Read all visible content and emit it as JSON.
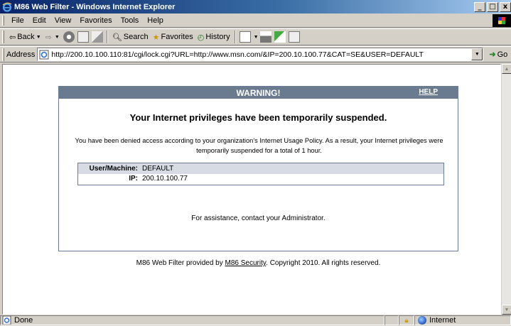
{
  "window": {
    "title": "M86 Web Filter - Windows Internet Explorer",
    "minimize": "_",
    "maximize": "□",
    "close": "x"
  },
  "menubar": {
    "items": [
      "File",
      "Edit",
      "View",
      "Favorites",
      "Tools",
      "Help"
    ]
  },
  "toolbar": {
    "back_label": "Back",
    "search_label": "Search",
    "favorites_label": "Favorites",
    "history_label": "History"
  },
  "addressbar": {
    "label": "Address",
    "url": "http://200.10.100.110:81/cgi/lock.cgi?URL=http://www.msn.com/&IP=200.10.100.77&CAT=SE&USER=DEFAULT",
    "go_label": "Go"
  },
  "page": {
    "header_title": "WARNING!",
    "help_link": "HELP",
    "headline": "Your Internet privileges have been temporarily suspended.",
    "body_text": "You have been denied access according to your organization's Internet Usage Policy. As a result, your Internet privileges were temporarily suspended for a total of 1 hour.",
    "info": {
      "user_label": "User/Machine:",
      "user_value": "DEFAULT",
      "ip_label": "IP:",
      "ip_value": "200.10.100.77"
    },
    "assistance": "For assistance, contact your Administrator.",
    "footer_prefix": "M86 Web Filter provided by ",
    "footer_link": "M86 Security",
    "footer_suffix": ". Copyright 2010. All rights reserved."
  },
  "statusbar": {
    "status_text": "Done",
    "zone_text": "Internet"
  },
  "colors": {
    "titlebar": "#0a246a",
    "warning_header": "#6b7b8f",
    "info_row": "#d6dbe4"
  }
}
